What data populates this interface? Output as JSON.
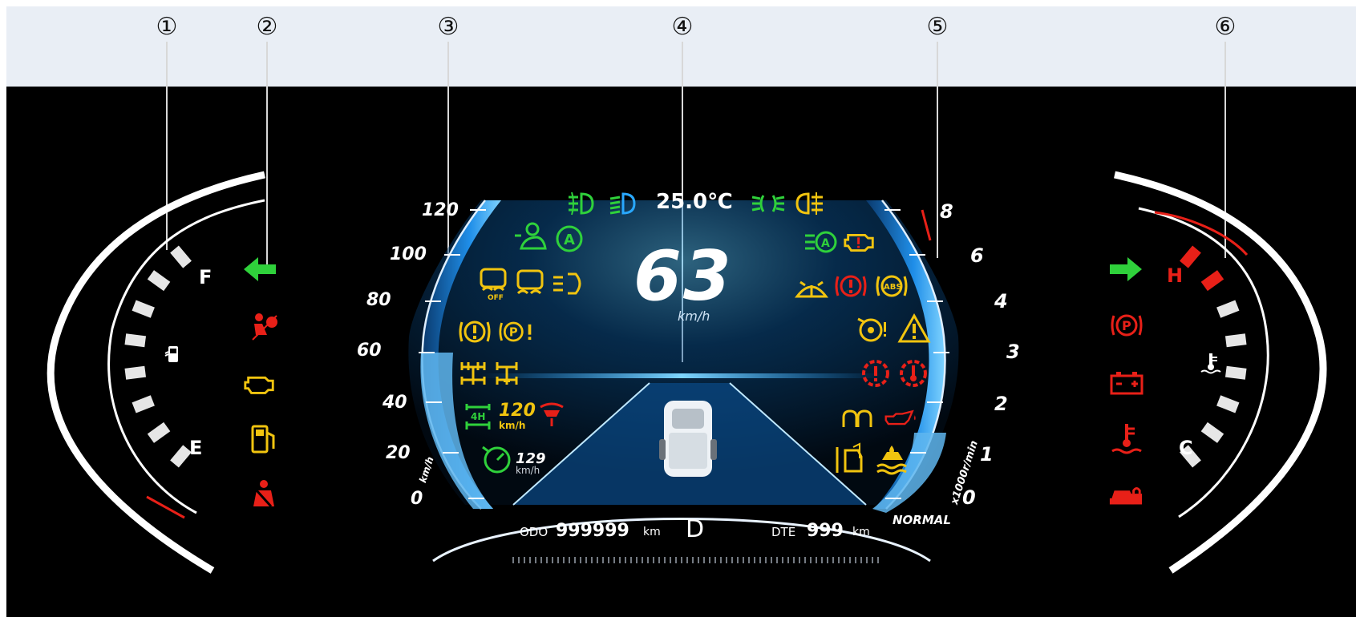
{
  "callouts": [
    "①",
    "②",
    "③",
    "④",
    "⑤",
    "⑥"
  ],
  "fuel_gauge": {
    "full_label": "F",
    "empty_label": "E",
    "fill_fraction": 0.9
  },
  "temp_gauge": {
    "hot_label": "H",
    "cold_label": "C",
    "fill_fraction": 0.8
  },
  "speedometer": {
    "ticks": [
      "120",
      "100",
      "80",
      "60",
      "40",
      "20",
      "0"
    ],
    "unit": "km/h",
    "value": 63,
    "display_value": "63",
    "display_unit": "km/h"
  },
  "tachometer": {
    "ticks": [
      "8",
      "6",
      "4",
      "3",
      "2",
      "1",
      "0"
    ],
    "unit": "x1000r/min",
    "value": 1.3,
    "mode": "NORMAL"
  },
  "top_bar": {
    "temperature": "25.0℃"
  },
  "cruise": {
    "set_speed": "120",
    "set_speed_unit": "km/h",
    "limit_speed": "129",
    "limit_speed_unit": "km/h"
  },
  "status": {
    "odo_label": "ODO",
    "odo_value": "999999",
    "odo_unit": "km",
    "gear": "D",
    "dte_label": "DTE",
    "dte_value": "999",
    "dte_unit": "km"
  },
  "icons": {
    "top_left": [
      "front-fog-light-icon",
      "low-beam-icon"
    ],
    "top_right": [
      "position-light-icon",
      "rear-fog-light-icon"
    ],
    "left": [
      "driver-monitor-icon",
      "auto-hold-icon",
      "esc-off-icon",
      "esc-icon",
      "lane-assist-icon",
      "brake-fault-icon",
      "epb-fault-icon",
      "4wd-low-icon",
      "4wd-lock-icon",
      "4h-icon",
      "hill-descent-icon",
      "speed-limit-icon"
    ],
    "right": [
      "auto-high-beam-icon",
      "engine-fault-icon",
      "washer-fluid-icon",
      "brake-warning-icon",
      "abs-icon",
      "eps-icon",
      "master-warning-icon",
      "transmission-fault-icon",
      "transmission-temp-icon",
      "glow-plug-icon",
      "oil-pressure-icon",
      "door-open-icon",
      "water-in-fuel-icon"
    ],
    "left_column": [
      "left-turn-icon",
      "airbag-icon",
      "engine-check-icon",
      "low-fuel-icon",
      "seatbelt-icon"
    ],
    "right_column": [
      "right-turn-icon",
      "parking-brake-icon",
      "battery-icon",
      "coolant-temp-icon",
      "anti-theft-icon"
    ]
  },
  "colors": {
    "green": "#2fd13b",
    "yellow": "#f1c40f",
    "red": "#e82018",
    "blue": "#29a8ff",
    "white": "#ffffff"
  }
}
